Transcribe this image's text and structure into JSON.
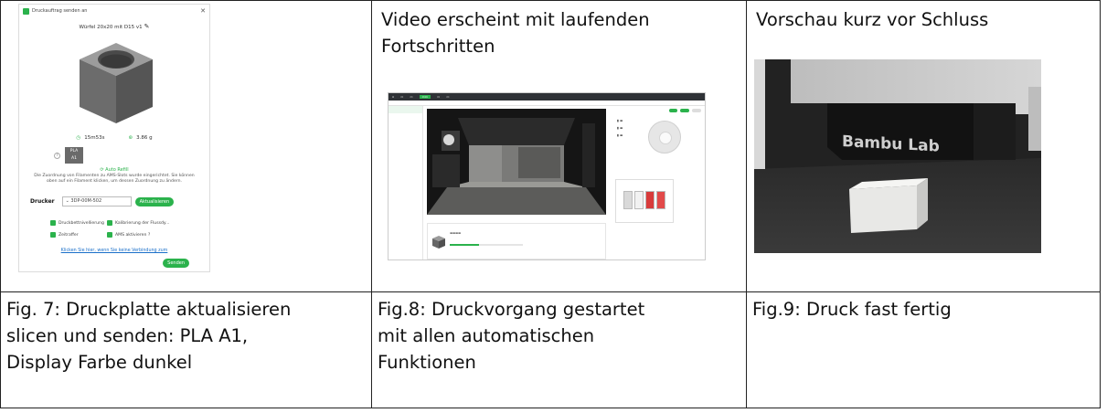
{
  "fig7": {
    "dialog": {
      "window_title": "Druckauftrag senden an",
      "plate_title": "Würfel 20x20 mit D15 v1",
      "print_time": "15m53s",
      "weight": "3.86 g",
      "filament_line1": "PLA",
      "filament_line2": "A1",
      "auto_refill": "Auto Refill",
      "message": "Die Zuordnung von Filamenten zu AMS-Slots wurde eingerichtet. Sie können oben auf ein Filament klicken, um dessen Zuordnung zu ändern.",
      "printer_label": "Drucker",
      "printer_value": "3DP-00M-502",
      "refresh_button": "Aktualisieren",
      "options": [
        "Druckbettnivellierung",
        "Kalibrierung der Flussdy...",
        "Zeitraffer",
        "AMS aktivieren"
      ],
      "help_link": "Klicken Sie hier, wenn Sie keine Verbindung zum",
      "send_button": "Senden"
    },
    "caption": "Fig. 7: Druckplatte aktualisieren\nslicen und senden: PLA A1,\nDisplay Farbe dunkel"
  },
  "fig8": {
    "heading": "Video erscheint mit laufenden\nFortschritten",
    "caption": "Fig.8: Druckvorgang gestartet\nmit allen automatischen\nFunktionen"
  },
  "fig9": {
    "heading": "Vorschau kurz vor Schluss",
    "photo_brand": "Bambu Lab",
    "caption": "Fig.9: Druck fast fertig"
  },
  "colors": {
    "accent": "#2bb24c",
    "link": "#1a6fc9",
    "border": "#222222"
  }
}
